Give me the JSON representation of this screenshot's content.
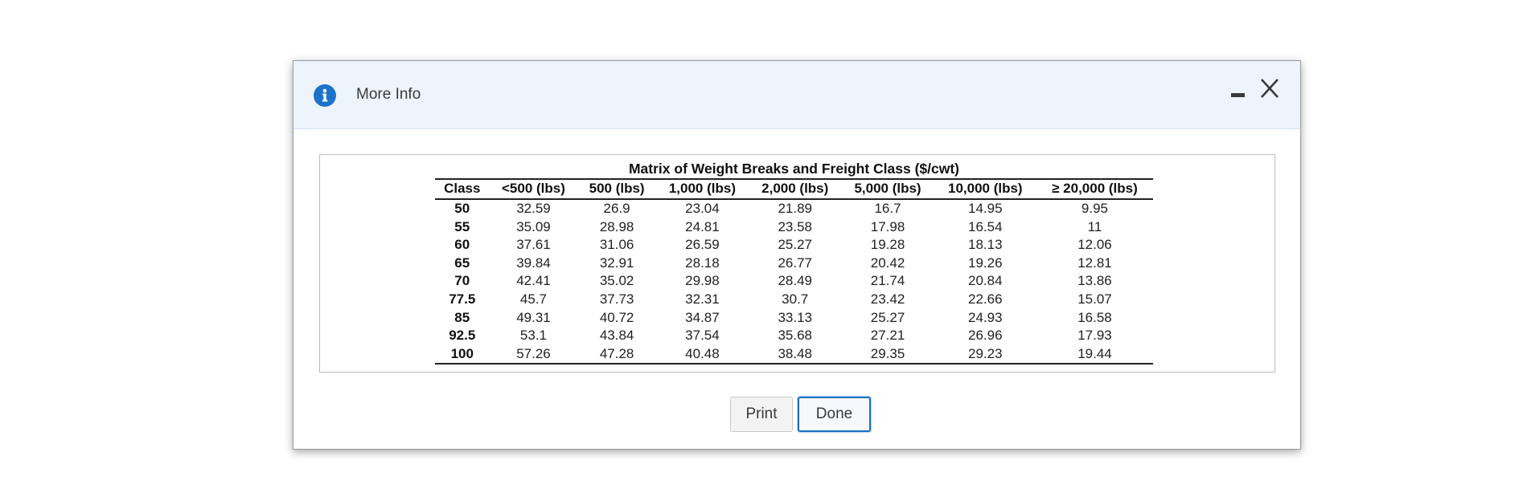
{
  "dialog": {
    "title": "More Info",
    "icon": "info-icon",
    "controls": {
      "minimize_icon": "minimize-icon",
      "close_icon": "close-icon"
    }
  },
  "table": {
    "caption": "Matrix of Weight Breaks and Freight Class ($/cwt)",
    "headers": [
      "Class",
      "<500 (lbs)",
      "500 (lbs)",
      "1,000 (lbs)",
      "2,000 (lbs)",
      "5,000 (lbs)",
      "10,000 (lbs)",
      "≥ 20,000 (lbs)"
    ],
    "rows": [
      [
        "50",
        "32.59",
        "26.9",
        "23.04",
        "21.89",
        "16.7",
        "14.95",
        "9.95"
      ],
      [
        "55",
        "35.09",
        "28.98",
        "24.81",
        "23.58",
        "17.98",
        "16.54",
        "11"
      ],
      [
        "60",
        "37.61",
        "31.06",
        "26.59",
        "25.27",
        "19.28",
        "18.13",
        "12.06"
      ],
      [
        "65",
        "39.84",
        "32.91",
        "28.18",
        "26.77",
        "20.42",
        "19.26",
        "12.81"
      ],
      [
        "70",
        "42.41",
        "35.02",
        "29.98",
        "28.49",
        "21.74",
        "20.84",
        "13.86"
      ],
      [
        "77.5",
        "45.7",
        "37.73",
        "32.31",
        "30.7",
        "23.42",
        "22.66",
        "15.07"
      ],
      [
        "85",
        "49.31",
        "40.72",
        "34.87",
        "33.13",
        "25.27",
        "24.93",
        "16.58"
      ],
      [
        "92.5",
        "53.1",
        "43.84",
        "37.54",
        "35.68",
        "27.21",
        "26.96",
        "17.93"
      ],
      [
        "100",
        "57.26",
        "47.28",
        "40.48",
        "38.48",
        "29.35",
        "29.23",
        "19.44"
      ]
    ]
  },
  "buttons": {
    "print_label": "Print",
    "done_label": "Done"
  },
  "colors": {
    "header_bg": "#eef4fc",
    "info_icon": "#1a73c9",
    "done_border": "#1a6fc2"
  }
}
